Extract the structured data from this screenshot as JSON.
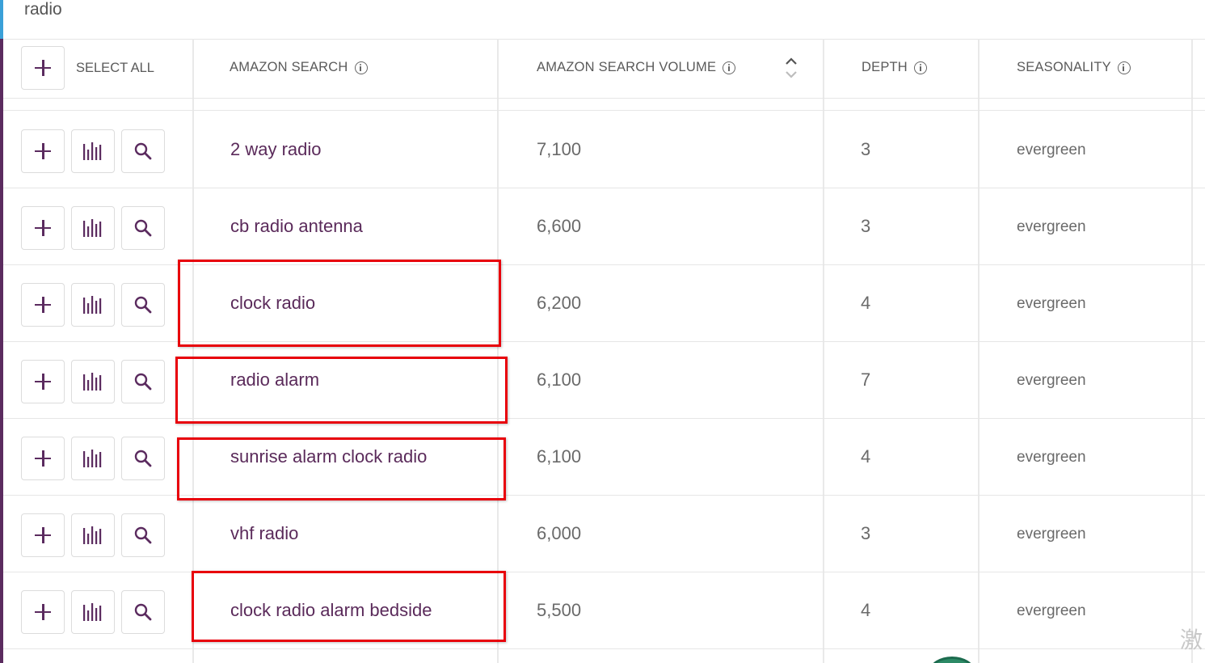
{
  "search": {
    "value": "radio"
  },
  "header": {
    "select_all": "SELECT ALL",
    "col_search": "AMAZON SEARCH",
    "col_volume": "AMAZON SEARCH VOLUME",
    "col_depth": "DEPTH",
    "col_season": "SEASONALITY"
  },
  "rows": [
    {
      "term": "2 way radio",
      "volume": "7,100",
      "depth": "3",
      "seasonality": "evergreen"
    },
    {
      "term": "cb radio antenna",
      "volume": "6,600",
      "depth": "3",
      "seasonality": "evergreen"
    },
    {
      "term": "clock radio",
      "volume": "6,200",
      "depth": "4",
      "seasonality": "evergreen"
    },
    {
      "term": "radio alarm",
      "volume": "6,100",
      "depth": "7",
      "seasonality": "evergreen"
    },
    {
      "term": "sunrise alarm clock radio",
      "volume": "6,100",
      "depth": "4",
      "seasonality": "evergreen"
    },
    {
      "term": "vhf radio",
      "volume": "6,000",
      "depth": "3",
      "seasonality": "evergreen"
    },
    {
      "term": "clock radio alarm bedside",
      "volume": "5,500",
      "depth": "4",
      "seasonality": "evergreen"
    }
  ],
  "icons": {
    "add": "plus-icon",
    "chart": "bar-chart-icon",
    "search": "magnifier-icon",
    "info": "info-icon",
    "sort": "sort-icon"
  },
  "watermark": "激",
  "colors": {
    "accent_purple": "#5b2b5f",
    "accent_blue": "#3aa0d8",
    "highlight_red": "#e8000b"
  }
}
